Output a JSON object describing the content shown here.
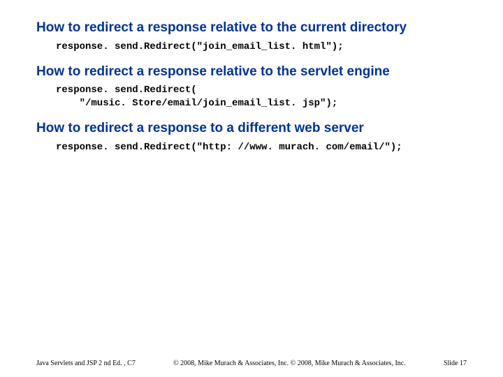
{
  "sections": [
    {
      "heading": "How to redirect a response relative to the current directory",
      "code": "response. send.Redirect(\"join_email_list. html\");"
    },
    {
      "heading": "How to redirect a response relative to the servlet engine",
      "code": "response. send.Redirect(\n    \"/music. Store/email/join_email_list. jsp\");"
    },
    {
      "heading": "How to redirect a response to a different web server",
      "code": "response. send.Redirect(\"http: //www. murach. com/email/\");"
    }
  ],
  "footer": {
    "left": "Java Servlets and JSP 2 nd Ed. , C7",
    "center": "© 2008, Mike Murach & Associates, Inc. © 2008, Mike Murach & Associates, Inc.",
    "right": "Slide 17"
  }
}
